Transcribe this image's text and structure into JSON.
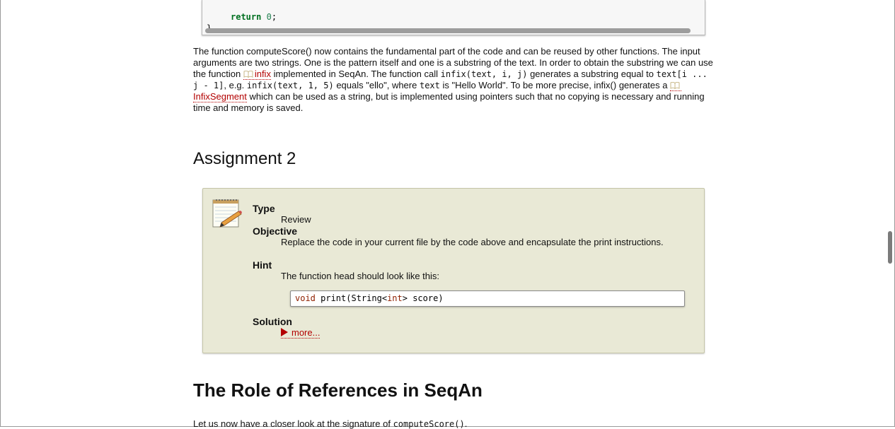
{
  "code_top": {
    "line1_keyword": "return",
    "line1_number": "0",
    "line1_end": ";",
    "line2": "}"
  },
  "para": {
    "t1": "The function computeScore() now contains the fundamental part of the code and can be reused by other functions. The input arguments are two strings. One is the pattern itself and one is a substring of the text. In order to obtain the substring we can use the function ",
    "link_infix": "infix",
    "t2": " implemented in SeqAn. The function call ",
    "code1": "infix(text, i, j)",
    "t3": " generates a substring equal to ",
    "code2": "text[i ... j - 1]",
    "t4": ", e.g. ",
    "code3": "infix(text, 1, 5)",
    "t5": " equals \"ello\", where ",
    "code4": "text",
    "t6": " is \"Hello World\". To be more precise, infix() generates a ",
    "link_segment": "InfixSegment",
    "t7": " which can be used as a string, but is implemented using pointers such that no copying is necessary and running time and memory is saved."
  },
  "assignment": {
    "heading": "Assignment 2",
    "type_label": "Type",
    "type_value": "Review",
    "objective_label": "Objective",
    "objective_value": "Replace the code in your current file by the code above and encapsulate the print instructions.",
    "hint_label": "Hint",
    "hint_value": "The function head should look like this:",
    "code_void": "void",
    "code_mid": " print(String<",
    "code_int": "int",
    "code_end": "> score)",
    "solution_label": "Solution",
    "more_label": "more..."
  },
  "role": {
    "heading": "The Role of References in SeqAn",
    "text": "Let us now have a closer look at the signature of ",
    "code": "computeScore()",
    "end": "."
  },
  "icons": {
    "book": "book-icon",
    "notepad": "notepad-pencil-icon"
  },
  "colors": {
    "link": "#b30000",
    "assign_bg": "#e9e9d6",
    "keyword_green": "#007020"
  }
}
